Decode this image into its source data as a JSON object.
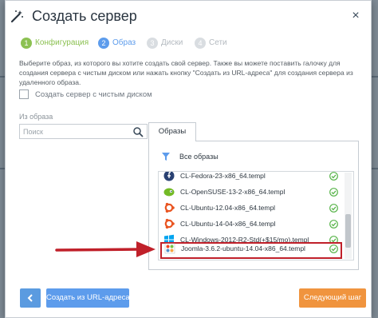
{
  "dialog": {
    "title": "Создать сервер",
    "close_label": "×"
  },
  "steps": [
    {
      "num": "1",
      "label": "Конфигурация",
      "state": "done"
    },
    {
      "num": "2",
      "label": "Образ",
      "state": "active"
    },
    {
      "num": "3",
      "label": "Диски",
      "state": "pending"
    },
    {
      "num": "4",
      "label": "Сети",
      "state": "pending"
    }
  ],
  "description": "Выберите образ, из которого вы хотите создать свой сервер. Также вы можете поставить галочку для создания сервера с чистым диском или нажать кнопку \"Создать из URL-адреса\" для создания сервера из удаленного образа.",
  "blank_disk": {
    "label": "Создать сервер с чистым диском",
    "checked": false
  },
  "from_image": {
    "label": "Из образа",
    "search_placeholder": "Поиск"
  },
  "images_tab": {
    "tab_label": "Образы",
    "filter_label": "Все образы",
    "items": [
      {
        "name": "CL-Fedora-23-x86_64.templ",
        "icon": "fedora-icon"
      },
      {
        "name": "CL-OpenSUSE-13-2-x86_64.templ",
        "icon": "opensuse-icon"
      },
      {
        "name": "CL-Ubuntu-12.04-x86_64.templ",
        "icon": "ubuntu-icon"
      },
      {
        "name": "CL-Ubuntu-14-04-x86_64.templ",
        "icon": "ubuntu-icon"
      },
      {
        "name": "CL-Windows-2012-R2-Std(+$15/mo).templ",
        "icon": "windows-icon"
      },
      {
        "name": "Joomla-3.6.2-ubuntu-14.04-x86_64.templ",
        "icon": "joomla-icon",
        "selected": true
      }
    ]
  },
  "footer": {
    "back_icon": "chevron-left-icon",
    "url_button": "Создать из URL-адреса",
    "next_button": "Следующий шаг"
  },
  "colors": {
    "done": "#8cc152",
    "active": "#5d9cec",
    "pending": "#d9dde1",
    "next_button": "#f0943e",
    "highlight": "#c0202a"
  }
}
